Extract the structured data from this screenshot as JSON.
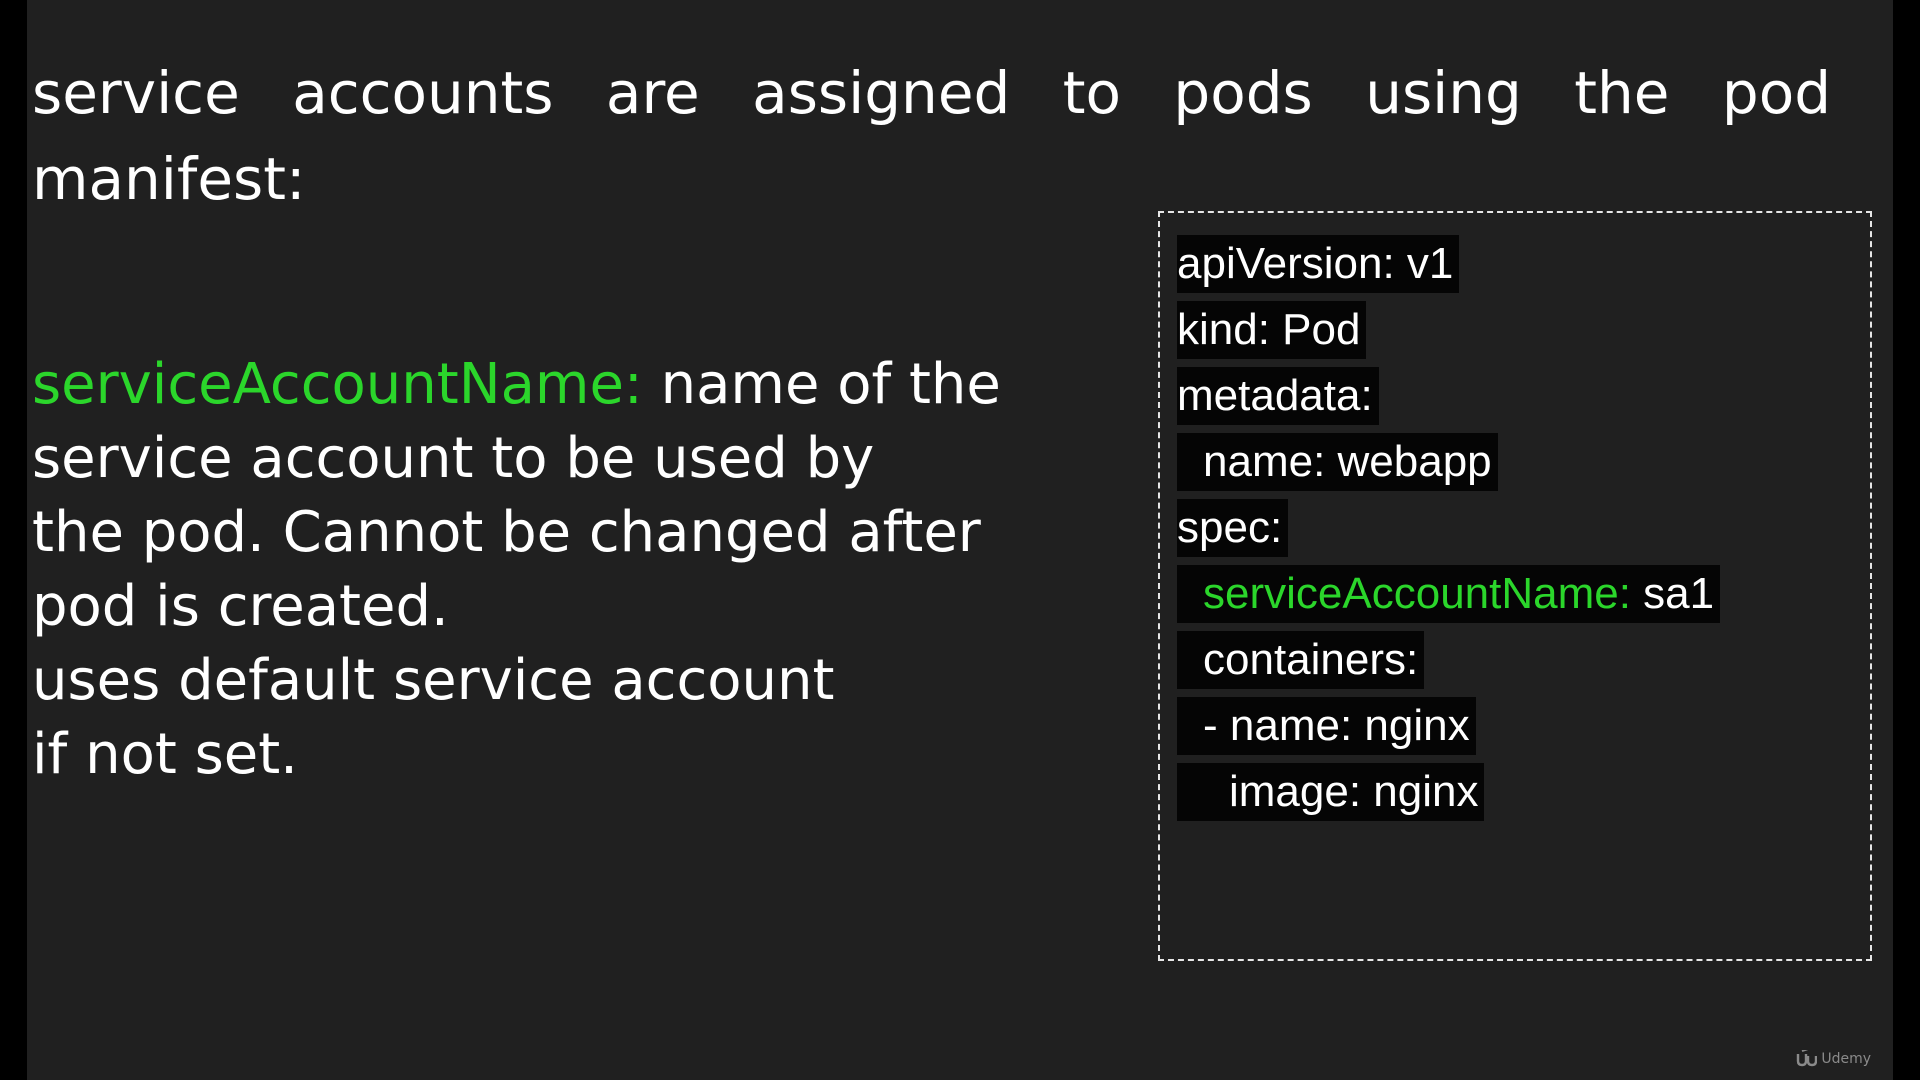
{
  "heading": {
    "line1": "service accounts are assigned to pods using the pod",
    "line2": "manifest:"
  },
  "description": {
    "term": "serviceAccountName:",
    "line1_rest": " name of the",
    "line2": "service account to be used by",
    "line3": "the pod. Cannot be changed after",
    "line4": "pod is created.",
    "line5": "uses default service account",
    "line6": "if not set."
  },
  "yaml": {
    "api_version": "apiVersion: v1",
    "kind": "kind: Pod",
    "metadata": "metadata:",
    "name": "name: webapp",
    "spec": "spec:",
    "sa_key": "serviceAccountName:",
    "sa_value": " sa1",
    "containers": "containers:",
    "container_name": "- name: nginx",
    "container_image": "image: nginx"
  },
  "brand": {
    "logo_icon": "udemy-logo-icon",
    "label": "Udemy"
  },
  "colors": {
    "background": "#202020",
    "highlight_green": "#2bd62b",
    "code_background": "#050505"
  }
}
